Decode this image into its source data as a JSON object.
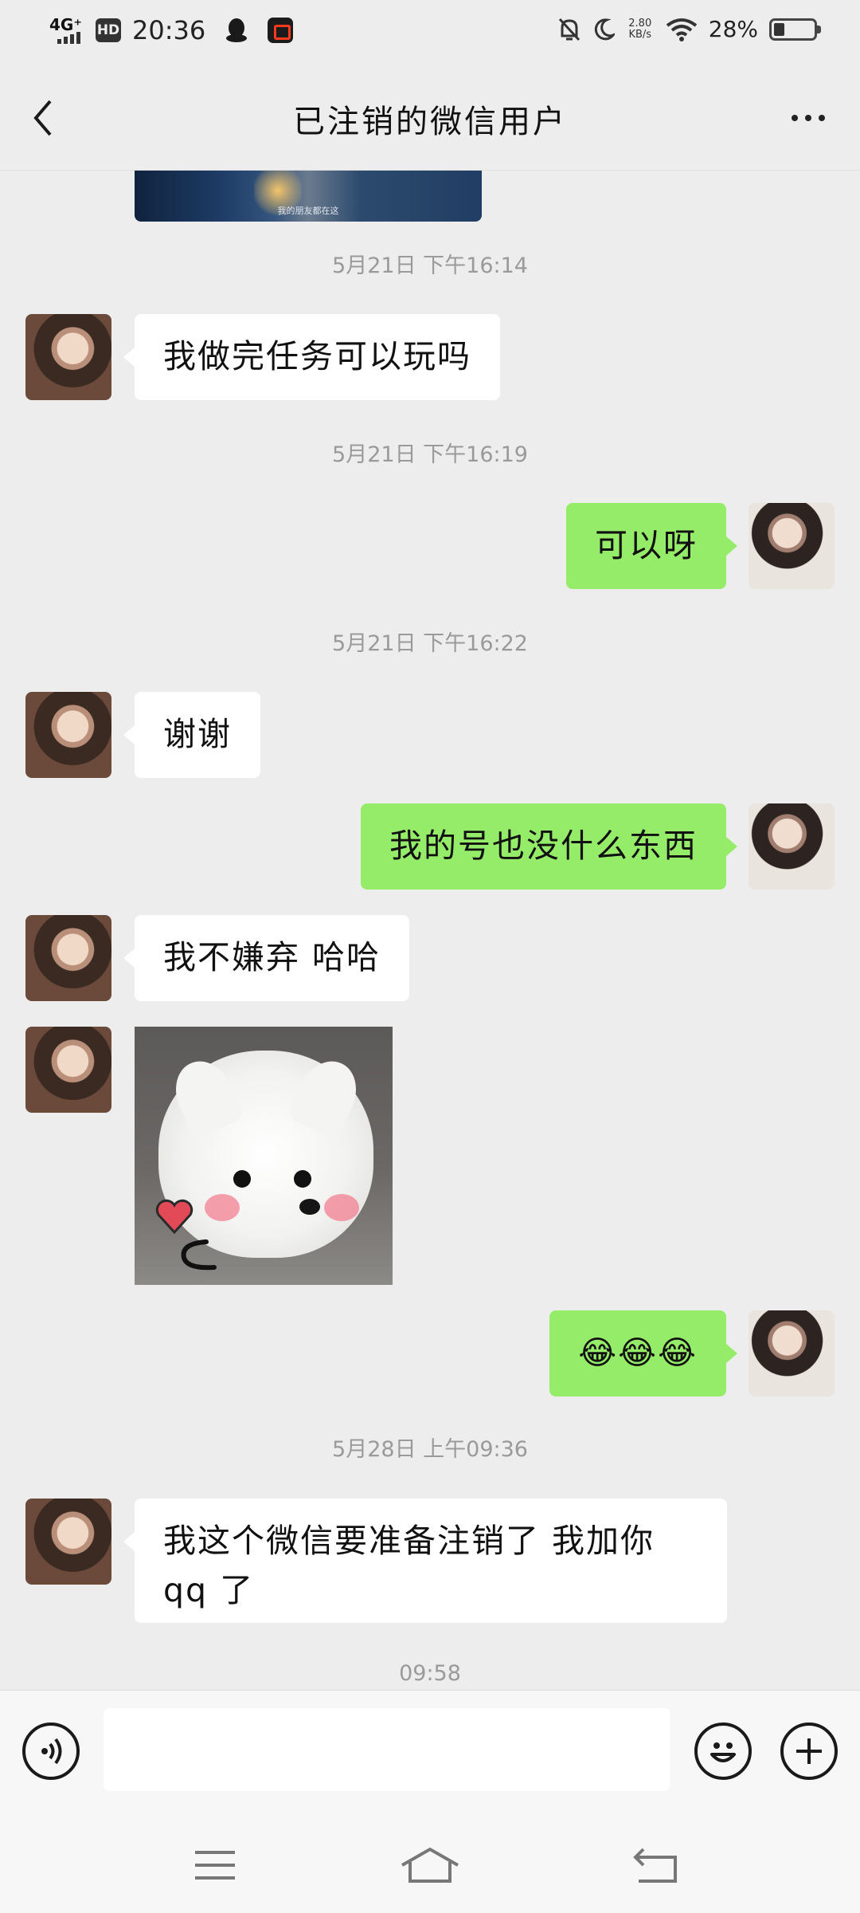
{
  "status_bar": {
    "network": "4G⁺",
    "hd": "HD",
    "time": "20:36",
    "speed_value": "2.80",
    "speed_unit": "KB/s",
    "battery_percent_text": "28%",
    "battery_level": 0.28,
    "icons": [
      "signal-icon",
      "qq-icon",
      "screen-record-icon",
      "mute-icon",
      "moon-icon",
      "wifi-icon",
      "battery-icon"
    ]
  },
  "header": {
    "title": "已注销的微信用户"
  },
  "messages": {
    "top_image_caption": "我的朋友都在这",
    "stamp1": "5月21日 下午16:14",
    "m1": "我做完任务可以玩吗",
    "stamp2": "5月21日 下午16:19",
    "m2": "可以呀",
    "stamp3": "5月21日 下午16:22",
    "m3": "谢谢",
    "m4": "我的号也没什么东西",
    "m5": "我不嫌弃 哈哈",
    "m6": "😂😂😂",
    "stamp4": "5月28日 上午09:36",
    "m7": "我这个微信要准备注销了 我加你qq 了",
    "stamp5": "09:58"
  },
  "input_bar": {
    "value": "",
    "placeholder": ""
  },
  "colors": {
    "background": "#ededed",
    "outgoing_bubble": "#95ec69",
    "incoming_bubble": "#ffffff",
    "timestamp": "#9a9a9a"
  }
}
